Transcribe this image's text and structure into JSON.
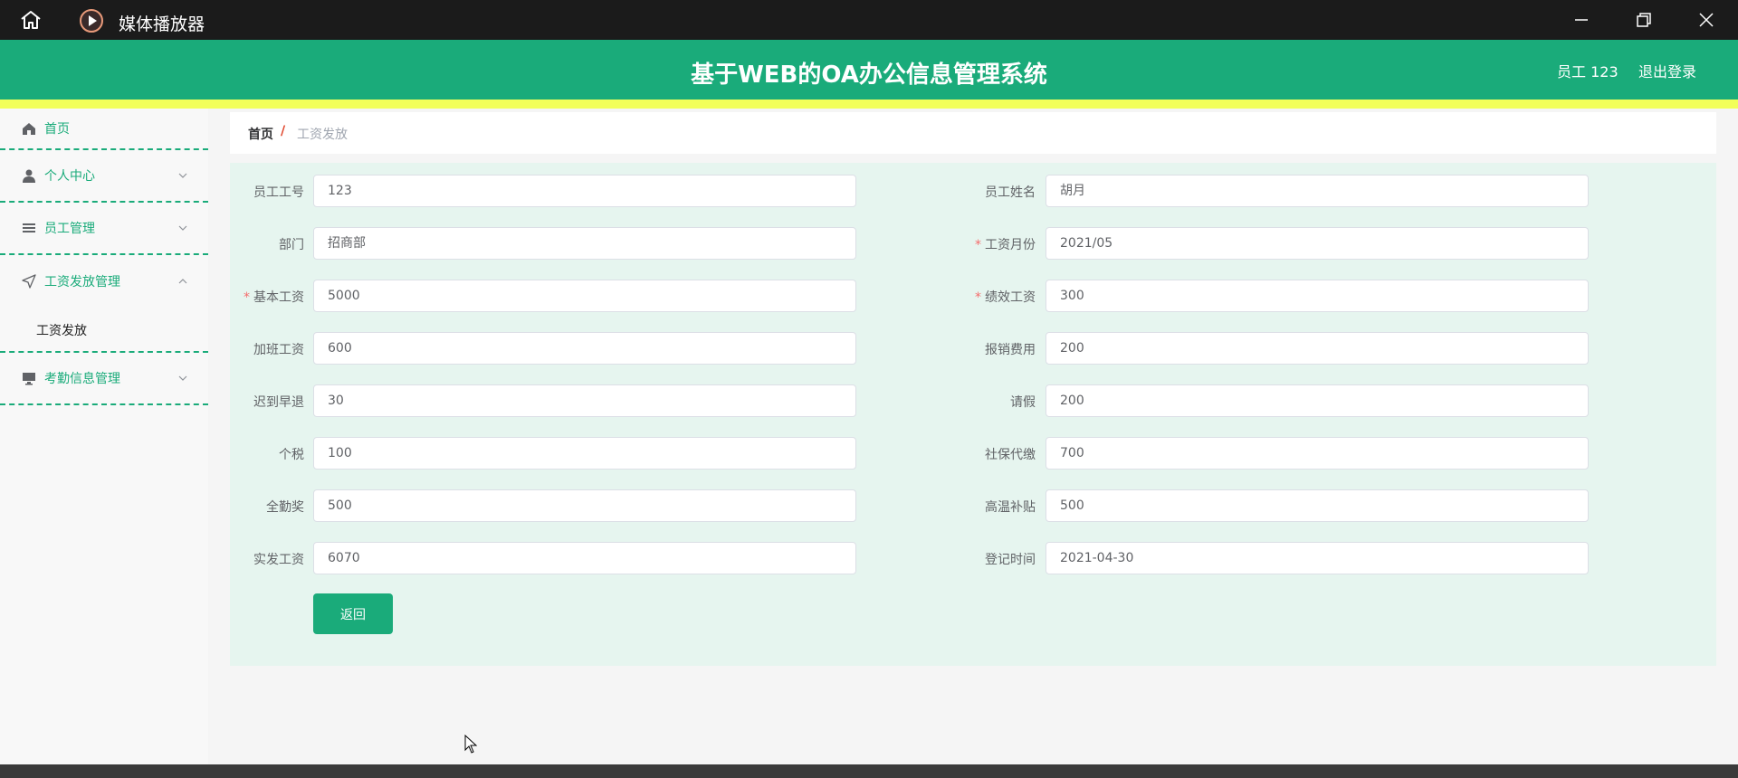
{
  "window": {
    "title": "媒体播放器"
  },
  "header": {
    "title": "基于WEB的OA办公信息管理系统",
    "user": "员工 123",
    "logout": "退出登录"
  },
  "sidebar": {
    "items": [
      {
        "label": "首页",
        "icon": "home-icon"
      },
      {
        "label": "个人中心",
        "icon": "user-icon"
      },
      {
        "label": "员工管理",
        "icon": "list-icon"
      },
      {
        "label": "工资发放管理",
        "icon": "send-icon"
      },
      {
        "label": "考勤信息管理",
        "icon": "monitor-icon"
      }
    ],
    "sub_item": "工资发放"
  },
  "breadcrumb": {
    "home": "首页",
    "sep": "/",
    "current": "工资发放"
  },
  "form": {
    "employee_no": {
      "label": "员工工号",
      "value": "123"
    },
    "employee_name": {
      "label": "员工姓名",
      "value": "胡月"
    },
    "department": {
      "label": "部门",
      "value": "招商部"
    },
    "salary_month": {
      "label": "工资月份",
      "value": "2021/05"
    },
    "base_salary": {
      "label": "基本工资",
      "value": "5000"
    },
    "performance": {
      "label": "绩效工资",
      "value": "300"
    },
    "overtime": {
      "label": "加班工资",
      "value": "600"
    },
    "reimbursement": {
      "label": "报销费用",
      "value": "200"
    },
    "late_early": {
      "label": "迟到早退",
      "value": "30"
    },
    "leave": {
      "label": "请假",
      "value": "200"
    },
    "tax": {
      "label": "个税",
      "value": "100"
    },
    "social_security": {
      "label": "社保代缴",
      "value": "700"
    },
    "attendance_bonus": {
      "label": "全勤奖",
      "value": "500"
    },
    "heat_allowance": {
      "label": "高温补贴",
      "value": "500"
    },
    "net_salary": {
      "label": "实发工资",
      "value": "6070"
    },
    "record_time": {
      "label": "登记时间",
      "value": "2021-04-30"
    },
    "back_button": "返回"
  },
  "colors": {
    "primary": "#1aab7a",
    "accent": "#f2ff5a",
    "required": "#f56c6c"
  }
}
